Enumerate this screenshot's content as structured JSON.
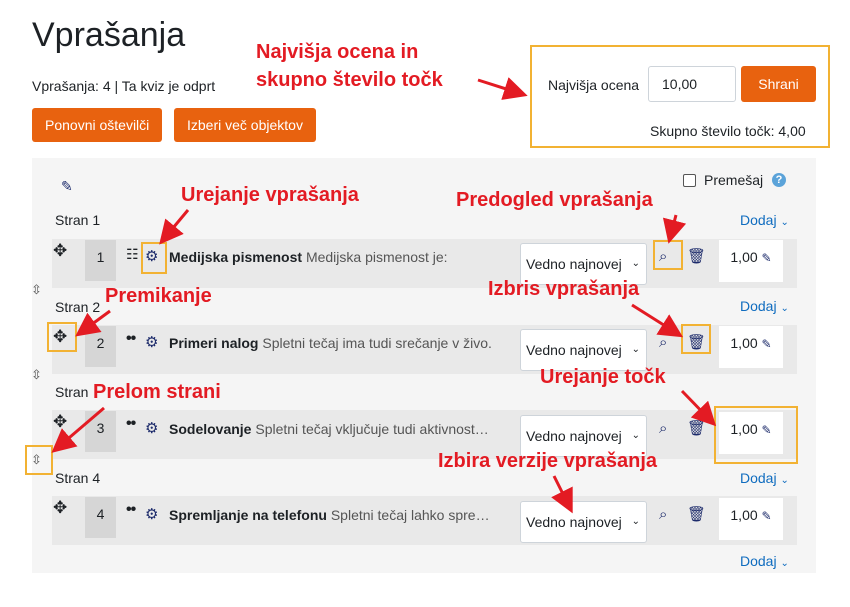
{
  "page": {
    "title": "Vprašanja",
    "status": "Vprašanja: 4 | Ta kviz je odprt"
  },
  "buttons": {
    "repaginate": "Ponovni oštevilči",
    "select_multiple": "Izberi več objektov"
  },
  "grade": {
    "label": "Najvišja ocena",
    "value": "10,00",
    "save": "Shrani",
    "total": "Skupno število točk: 4,00"
  },
  "shuffle": {
    "label": "Premešaj"
  },
  "add_label": "Dodaj",
  "pages": [
    {
      "label": "Stran 1"
    },
    {
      "label": "Stran 2"
    },
    {
      "label": "Stran"
    },
    {
      "label": "Stran 4"
    }
  ],
  "questions": [
    {
      "num": "1",
      "name": "Medijska pismenost",
      "text": "Medijska pismenost je:",
      "version": "Vedno najnovej",
      "mark": "1,00"
    },
    {
      "num": "2",
      "name": "Primeri nalog",
      "text": "Spletni tečaj ima tudi srečanje v živo.",
      "version": "Vedno najnovej",
      "mark": "1,00"
    },
    {
      "num": "3",
      "name": "Sodelovanje",
      "text": "Spletni tečaj vključuje tudi aktivnost…",
      "version": "Vedno najnovej",
      "mark": "1,00"
    },
    {
      "num": "4",
      "name": "Spremljanje na telefonu",
      "text": "Spletni tečaj lahko spre…",
      "version": "Vedno najnovej",
      "mark": "1,00"
    }
  ],
  "annotations": {
    "grade": "Najvišja ocena in",
    "grade2": "skupno število točk",
    "edit_question": "Urejanje vprašanja",
    "preview": "Predogled vprašanja",
    "move": "Premikanje",
    "delete": "Izbris vprašanja",
    "page_break": "Prelom strani",
    "edit_marks": "Urejanje točk",
    "version": "Izbira verzije vprašanja"
  },
  "colors": {
    "accent": "#e8620f",
    "highlight": "#f2b233",
    "annotation": "#e31b23",
    "link": "#0f6cbf"
  }
}
